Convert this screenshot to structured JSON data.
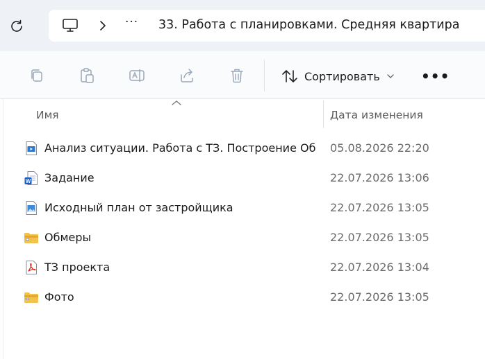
{
  "address": {
    "overflow": "···",
    "current_folder": "33. Работа с планировками. Средняя квартира"
  },
  "toolbar": {
    "sort_label": "Сортировать",
    "more": "•••"
  },
  "columns": {
    "name": "Имя",
    "date": "Дата изменения"
  },
  "files": [
    {
      "name": "Анализ ситуации. Работа с ТЗ. Построение Об…",
      "date": "05.08.2026 22:20",
      "icon": "video-file-icon"
    },
    {
      "name": "Задание",
      "date": "22.07.2026 13:06",
      "icon": "word-file-icon"
    },
    {
      "name": "Исходный план от застройщика",
      "date": "22.07.2026 13:05",
      "icon": "image-file-icon"
    },
    {
      "name": "Обмеры",
      "date": "22.07.2026 13:05",
      "icon": "zip-folder-icon"
    },
    {
      "name": "ТЗ проекта",
      "date": "22.07.2026 13:04",
      "icon": "pdf-file-icon"
    },
    {
      "name": "Фото",
      "date": "22.07.2026 13:05",
      "icon": "zip-folder-icon"
    }
  ],
  "colors": {
    "accent": "#1a73e8",
    "pdf": "#d93025",
    "word": "#185abd",
    "folder": "#f2c14e"
  }
}
